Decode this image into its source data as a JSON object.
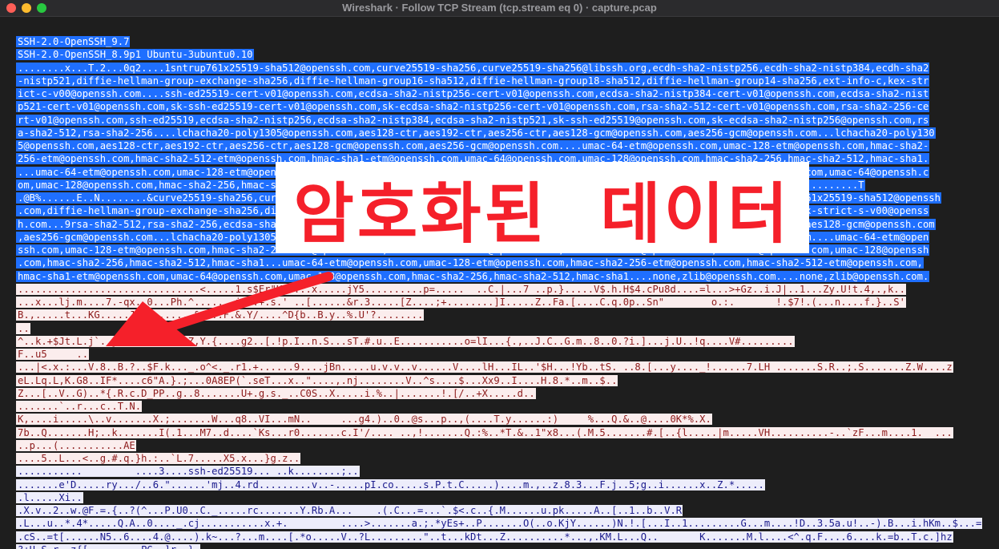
{
  "window": {
    "title": "Wireshark · Follow TCP Stream (tcp.stream eq 0) · capture.pcap"
  },
  "annotation": {
    "text": "암호화된  데이터",
    "color": "#f5202a"
  },
  "colors": {
    "client_bg": "#fbeded",
    "client_fg": "#8c1a1a",
    "server_bg": "#ededfb",
    "server_fg": "#1a1a8c",
    "selected": "#1f6fff"
  },
  "stream": {
    "lines": [
      {
        "t": "SSH-2.0-OpenSSH_9.7",
        "dir": "srv",
        "sel": true
      },
      {
        "t": "SSH-2.0-OpenSSH_8.9p1 Ubuntu-3ubuntu0.10",
        "dir": "srv",
        "sel": true
      },
      {
        "t": "........x...T.2...0q2....1sntrup761x25519-sha512@openssh.com,curve25519-sha256,curve25519-sha256@libssh.org,ecdh-sha2-nistp256,ecdh-sha2-nistp384,ecdh-sha2",
        "dir": "cli",
        "sel": true
      },
      {
        "t": "-nistp521,diffie-hellman-group-exchange-sha256,diffie-hellman-group16-sha512,diffie-hellman-group18-sha512,diffie-hellman-group14-sha256,ext-info-c,kex-str",
        "dir": "cli",
        "sel": true
      },
      {
        "t": "ict-c-v00@openssh.com....ssh-ed25519-cert-v01@openssh.com,ecdsa-sha2-nistp256-cert-v01@openssh.com,ecdsa-sha2-nistp384-cert-v01@openssh.com,ecdsa-sha2-nist",
        "dir": "cli",
        "sel": true
      },
      {
        "t": "p521-cert-v01@openssh.com,sk-ssh-ed25519-cert-v01@openssh.com,sk-ecdsa-sha2-nistp256-cert-v01@openssh.com,rsa-sha2-512-cert-v01@openssh.com,rsa-sha2-256-ce",
        "dir": "cli",
        "sel": true
      },
      {
        "t": "rt-v01@openssh.com,ssh-ed25519,ecdsa-sha2-nistp256,ecdsa-sha2-nistp384,ecdsa-sha2-nistp521,sk-ssh-ed25519@openssh.com,sk-ecdsa-sha2-nistp256@openssh.com,rs",
        "dir": "cli",
        "sel": true
      },
      {
        "t": "a-sha2-512,rsa-sha2-256....lchacha20-poly1305@openssh.com,aes128-ctr,aes192-ctr,aes256-ctr,aes128-gcm@openssh.com,aes256-gcm@openssh.com...lchacha20-poly130",
        "dir": "cli",
        "sel": true
      },
      {
        "t": "5@openssh.com,aes128-ctr,aes192-ctr,aes256-ctr,aes128-gcm@openssh.com,aes256-gcm@openssh.com....umac-64-etm@openssh.com,umac-128-etm@openssh.com,hmac-sha2-",
        "dir": "cli",
        "sel": true
      },
      {
        "t": "256-etm@openssh.com,hmac-sha2-512-etm@openssh.com,hmac-sha1-etm@openssh.com,umac-64@openssh.com,umac-128@openssh.com,hmac-sha2-256,hmac-sha2-512,hmac-sha1.",
        "dir": "cli",
        "sel": true
      },
      {
        "t": "...umac-64-etm@openssh.com,umac-128-etm@openssh.com,hmac-sha2-256-etm@openssh.com,hmac-sha2-512-etm@openssh.com,hmac-sha1-etm@openssh.com,umac-64@openssh.c",
        "dir": "cli",
        "sel": true
      },
      {
        "t": "om,umac-128@openssh.com,hmac-sha2-256,hmac-sha2-512,hmac-sha1....none,zlib@openssh.com,zlib....none,zlib@openssh.com,zlib......................T",
        "dir": "cli",
        "sel": true
      },
      {
        "t": ".@B%......E..N........&curve25519-sha256,curve25519-sha256@libssh.org,ecdh-sha2-nistp256,ecdh-sha2-nistp384,ecdh-sha2-nistp521,sntrup761x25519-sha512@openssh",
        "dir": "srv",
        "sel": true
      },
      {
        "t": ".com,diffie-hellman-group-exchange-sha256,diffie-hellman-group16-sha512,diffie-hellman-group18-sha512,diffie-hellman-group14-sha256,kex-strict-s-v00@openss",
        "dir": "srv",
        "sel": true
      },
      {
        "t": "h.com...9rsa-sha2-512,rsa-sha2-256,ecdsa-sha2-nistp256,ssh-ed25519....lchacha20-poly1305@openssh.com,aes128-ctr,aes192-ctr,aes256-ctr,aes128-gcm@openssh.com",
        "dir": "srv",
        "sel": true
      },
      {
        "t": ",aes256-gcm@openssh.com...lchacha20-poly1305@openssh.com,aes128-ctr,aes192-ctr,aes256-ctr,aes128-gcm@openssh.com,aes256-gcm@openssh.com....umac-64-etm@open",
        "dir": "srv",
        "sel": true
      },
      {
        "t": "ssh.com,umac-128-etm@openssh.com,hmac-sha2-256-etm@openssh.com,hmac-sha2-512-etm@openssh.com,hmac-sha1-etm@openssh.com,umac-64@openssh.com,umac-128@openssh",
        "dir": "srv",
        "sel": true
      },
      {
        "t": ".com,hmac-sha2-256,hmac-sha2-512,hmac-sha1...umac-64-etm@openssh.com,umac-128-etm@openssh.com,hmac-sha2-256-etm@openssh.com,hmac-sha2-512-etm@openssh.com,",
        "dir": "srv",
        "sel": true
      },
      {
        "t": "hmac-sha1-etm@openssh.com,umac-64@openssh.com,umac-128@openssh.com,hmac-sha2-256,hmac-sha2-512,hmac-sha1....none,zlib@openssh.com....none,zlib@openssh.com.",
        "dir": "srv",
        "sel": true
      },
      {
        "t": "...............................<.....1.s$Er\"K.....x.....jY5..........p=.....  ..C.|...7 ..p.}.....V$.h.H$4.cPu8d....=l...>+Gz..i.J|..1...Zy.U!t.4,.,k..",
        "dir": "cli",
        "sel": false
      },
      {
        "t": "...x...lj.m....7.-qx..0...Ph.^.......i4..+.s.' ..[......&r.3.....[Z....;+........]I.....Z..Fa.[....C.q.0p..Sn\"        o.:.       !.$7!.(...n....f.}..S'",
        "dir": "cli",
        "sel": false
      },
      {
        "t": "B.,.....t...KG.....JR.........&.5..F.&.Y/....^D{b..B.y..%.U'?........",
        "dir": "cli",
        "sel": false
      },
      {
        "t": "..",
        "dir": "cli",
        "sel": false
      },
      {
        "t": "^..k.+$Jt.L.j`..j.z.[.....JP.Z,Y.{....g2..[.!p.I..n.S...sT.#.u..E...........o=lI...{.,..J.C..G.m..8..0.?i.]...j.U..!q....V#.........",
        "dir": "cli",
        "sel": false
      },
      {
        "t": "F..u5     ..",
        "dir": "cli",
        "sel": false
      },
      {
        "t": "...|<.x.:...V.8..B.?..$F.k..._.o^<._.r1.+......9....jBn.....u.v.v..v......V....lH...IL..'$H...!Yb..tS. ..8.[...y...._!......7.LH .......S.R..;.S.......Z.W....z",
        "dir": "cli",
        "sel": false
      },
      {
        "t": "eL.Lq.L,K.G8..IF*....c6\"A.}.;...0A8EP(`.seT...x..\"....,.nj........V..^s....$...Xx9..I....H.8.*..m..$..",
        "dir": "cli",
        "sel": false
      },
      {
        "t": "Z...[..V..G)..*{.R.c.D_PP..g..8.......U+.g.s._..C0S..X.....i.%..|.......!.[/..+X.....d..",
        "dir": "cli",
        "sel": false
      },
      {
        "t": ".......`..r...c..T.N.",
        "dir": "cli",
        "sel": false
      },
      {
        "t": "K,....i.....\\..v.......X.;.......W...q8..VI...mN..     ...g4.)..0..@s...p..,(....T.y......:)     %...Q.&..@....0K*%.X.",
        "dir": "cli",
        "sel": false
      },
      {
        "t": "7b..Q.......H;..k.......I(.1...M7..d....`Ks...r0.......c.I'/.... ..,!.......Q.:%..*T.&..1\"x8...(.M.5.......#.[..{l.....|m.....VH..........-..`zF...m....1.  ...",
        "dir": "cli",
        "sel": false
      },
      {
        "t": "..p...(...........AE",
        "dir": "cli",
        "sel": false
      },
      {
        "t": "....5..L...<..g.#.q.}h.:..`L.7.....X5.x...}g.z..",
        "dir": "cli",
        "sel": false
      },
      {
        "t": "...........         ....3....ssh-ed25519... ..k........;..",
        "dir": "srv",
        "sel": false
      },
      {
        "t": ".......e'D.....ry.../..6.\"......'mj..4.rd.........v..-.....pI.co.....s.P.t.C.....)....m.,..z.8.3...F.j..5;g..i......x..Z.*.....",
        "dir": "srv",
        "sel": false
      },
      {
        "t": ".l.....Xi..",
        "dir": "srv",
        "sel": false
      },
      {
        "t": ".X.v..2..w.@F.=.{..?(^...P.U0..C._.....rc.......Y.Rb.A...    .(.C...=...`.$<.c..{.M......u.pk.....A..[..1..b..V.R",
        "dir": "srv",
        "sel": false
      },
      {
        "t": ".L...u..*.4*.....Q.A..0...._.cj...........x.+.         ....>.......a.;.*yEs+..P.......O(..o.KjY......)N.!.[...I..1.........G...m....!D..3.5a.u!..-).B...i.hKm..$...=",
        "dir": "srv",
        "sel": false
      },
      {
        "t": ".cS..=t[......N5..6....4.@....).k~...?...m....[.*o.....V..?L.........\"..t...kDt...Z..........*...,.KM.L...Q..       K.......M.l....<^.q.F....6....k.=b..T.c.]hz",
        "dir": "srv",
        "sel": false
      },
      {
        "t": "?+U.S.r..z{[.........PG..]r..}.",
        "dir": "srv",
        "sel": false
      }
    ]
  }
}
